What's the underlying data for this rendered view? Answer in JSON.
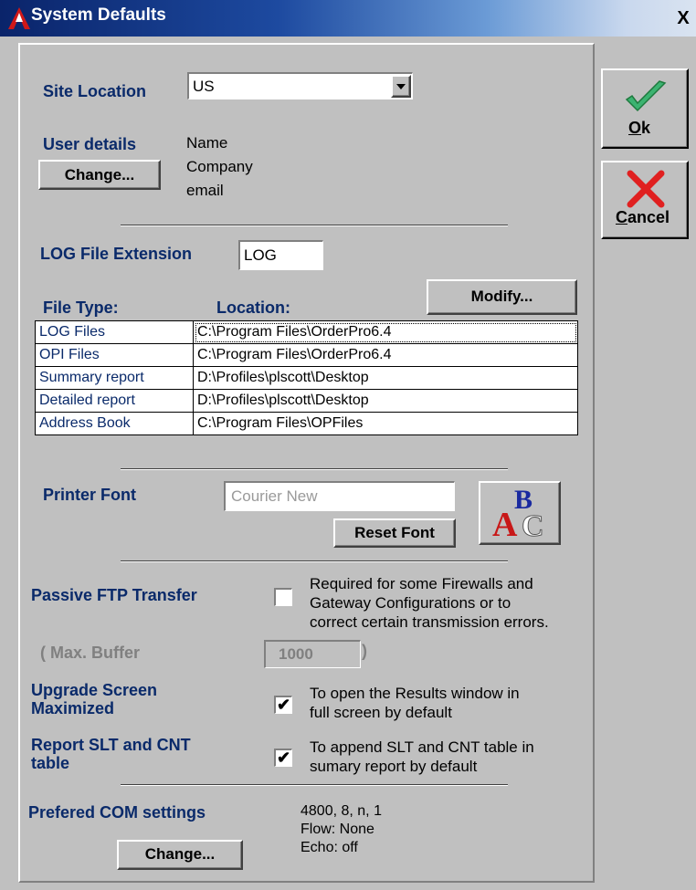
{
  "window": {
    "title": "System Defaults",
    "close_glyph": "X"
  },
  "site_location": {
    "label": "Site Location",
    "value": "US"
  },
  "user_details": {
    "label": "User details",
    "change_label": "Change...",
    "lines": [
      "Name",
      "Company",
      "email"
    ]
  },
  "log_extension": {
    "label": "LOG File Extension",
    "value": "LOG"
  },
  "file_table": {
    "header_type": "File Type:",
    "header_location": "Location:",
    "modify_label": "Modify...",
    "rows": [
      {
        "type": "LOG Files",
        "location": "C:\\Program Files\\OrderPro6.4"
      },
      {
        "type": "OPI Files",
        "location": "C:\\Program Files\\OrderPro6.4"
      },
      {
        "type": "Summary report",
        "location": "D:\\Profiles\\plscott\\Desktop"
      },
      {
        "type": "Detailed report",
        "location": "D:\\Profiles\\plscott\\Desktop"
      },
      {
        "type": "Address Book",
        "location": "C:\\Program Files\\OPFiles"
      }
    ]
  },
  "printer_font": {
    "label": "Printer Font",
    "value": "Courier New",
    "reset_label": "Reset Font",
    "icon": "font-abc-icon"
  },
  "passive_ftp": {
    "label": "Passive FTP Transfer",
    "checked": false,
    "desc": [
      "Required for some Firewalls and",
      "Gateway Configurations or to",
      "correct certain transmission errors."
    ]
  },
  "max_buffer": {
    "label": "( Max. Buffer",
    "value": "1000",
    "close": ")"
  },
  "upgrade_screen": {
    "label": [
      "Upgrade Screen",
      "Maximized"
    ],
    "checked": true,
    "desc": [
      "To open the Results window in",
      "full screen by default"
    ]
  },
  "report_slt": {
    "label": [
      "Report SLT and CNT",
      "table"
    ],
    "checked": true,
    "desc": [
      "To append SLT and CNT table in",
      "sumary report by default"
    ]
  },
  "com_settings": {
    "label": "Prefered COM settings",
    "change_label": "Change...",
    "lines": [
      "4800, 8, n, 1",
      "Flow: None",
      "Echo: off"
    ]
  },
  "ok_button": {
    "label_prefix": "O",
    "label_rest": "k",
    "icon": "checkmark-icon"
  },
  "cancel_button": {
    "label_prefix": "C",
    "label_rest": "ancel",
    "icon": "red-x-icon"
  },
  "check_glyph": "✔",
  "colors": {
    "label_blue": "#0a2a6a",
    "titlebar_start": "#0a246a",
    "check_green": "#3cb371",
    "cancel_red": "#e02020"
  }
}
